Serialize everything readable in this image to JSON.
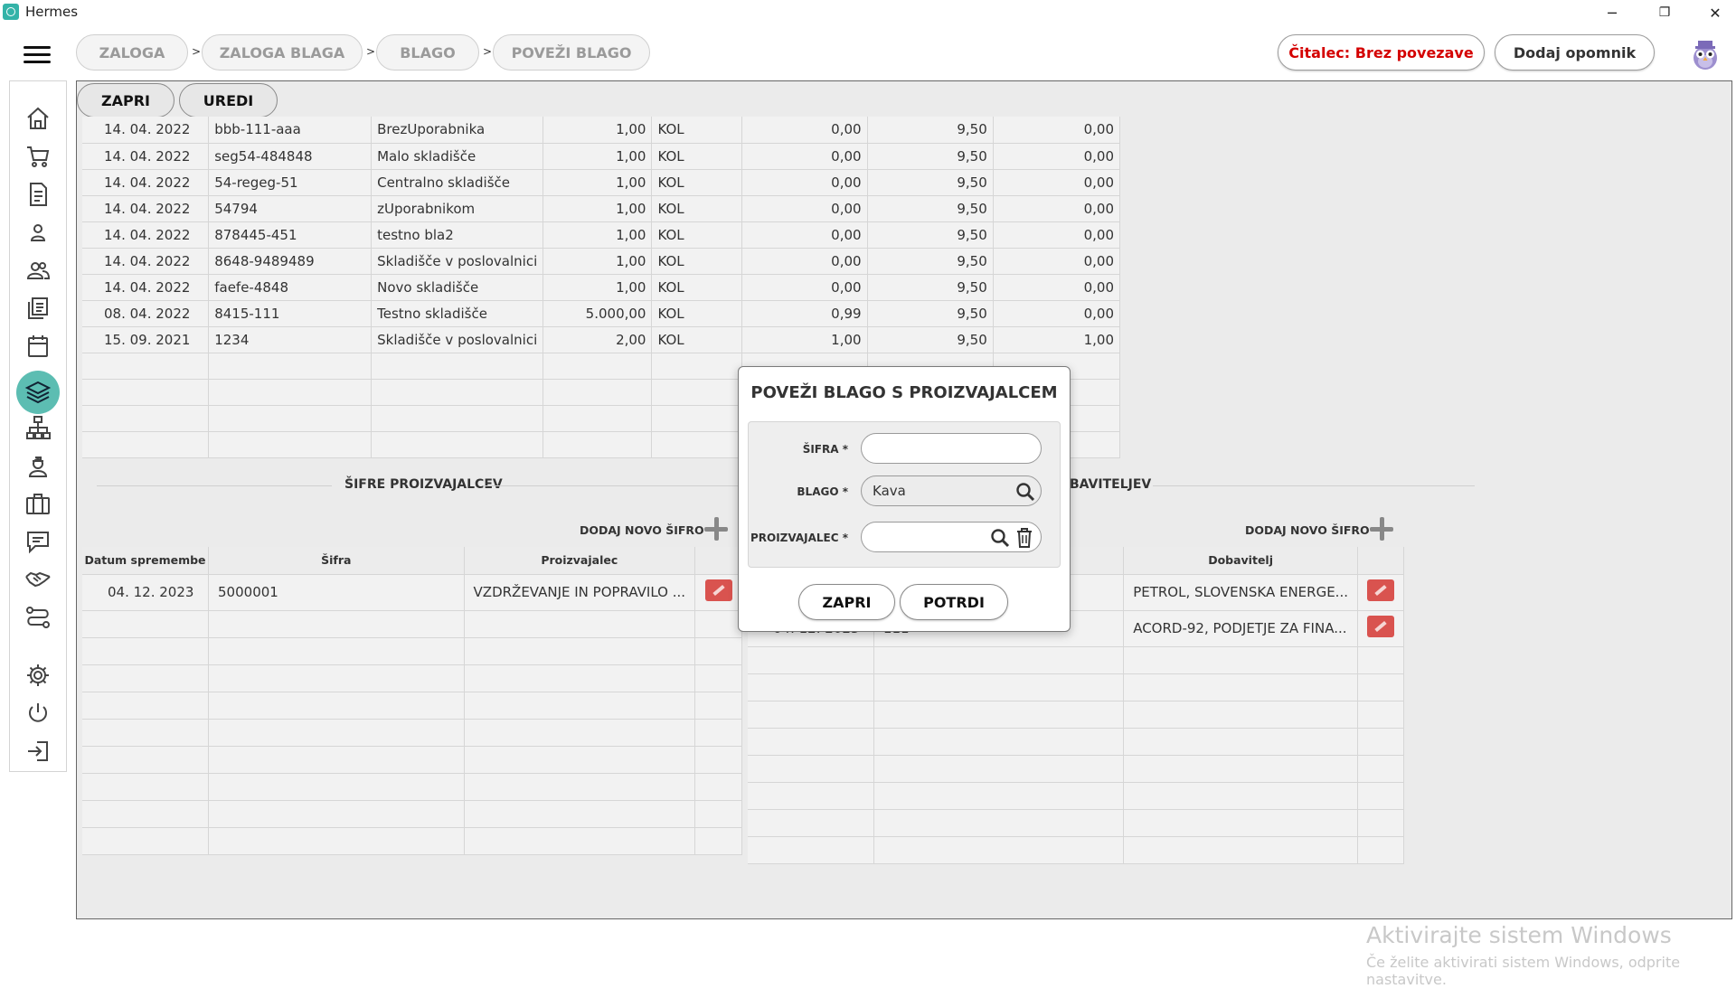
{
  "app": {
    "title": "Hermes"
  },
  "window_controls": {
    "minimize": "─",
    "restore": "❐",
    "close": "✕"
  },
  "breadcrumb": [
    {
      "label": "ZALOGA"
    },
    {
      "label": "ZALOGA BLAGA"
    },
    {
      "label": "BLAGO"
    },
    {
      "label": "POVEŽI BLAGO"
    }
  ],
  "breadcrumb_separator": ">",
  "header": {
    "reader_status": "Čitalec: Brez povezave",
    "reader_status_color": "#d40000",
    "add_reminder": "Dodaj opomnik"
  },
  "sidebar_icons": [
    "home-icon",
    "cart-icon",
    "document-icon",
    "person-icon",
    "people-icon",
    "documents-icon",
    "calendar-icon",
    "layers-icon",
    "hierarchy-icon",
    "worker-icon",
    "briefcase-icon",
    "chat-icon",
    "handshake-icon",
    "route-icon",
    "gear-icon",
    "power-icon",
    "logout-icon"
  ],
  "toolbar": {
    "close": "ZAPRI",
    "edit": "UREDI"
  },
  "stock_table": {
    "rows": [
      [
        "14. 04. 2022",
        "bbb-111-aaa",
        "BrezUporabnika",
        "1,00",
        "KOL",
        "0,00",
        "9,50",
        "0,00"
      ],
      [
        "14. 04. 2022",
        "seg54-484848",
        "Malo skladišče",
        "1,00",
        "KOL",
        "0,00",
        "9,50",
        "0,00"
      ],
      [
        "14. 04. 2022",
        "54-regeg-51",
        "Centralno skladišče",
        "1,00",
        "KOL",
        "0,00",
        "9,50",
        "0,00"
      ],
      [
        "14. 04. 2022",
        "54794",
        "zUporabnikom",
        "1,00",
        "KOL",
        "0,00",
        "9,50",
        "0,00"
      ],
      [
        "14. 04. 2022",
        "878445-451",
        "testno bla2",
        "1,00",
        "KOL",
        "0,00",
        "9,50",
        "0,00"
      ],
      [
        "14. 04. 2022",
        "8648-9489489",
        "Skladišče v poslovalnici",
        "1,00",
        "KOL",
        "0,00",
        "9,50",
        "0,00"
      ],
      [
        "14. 04. 2022",
        "faefe-4848",
        "Novo skladišče",
        "1,00",
        "KOL",
        "0,00",
        "9,50",
        "0,00"
      ],
      [
        "08. 04. 2022",
        "8415-111",
        "Testno skladišče",
        "5.000,00",
        "KOL",
        "0,99",
        "9,50",
        "0,00"
      ],
      [
        "15. 09. 2021",
        "1234",
        "Skladišče v poslovalnici",
        "2,00",
        "KOL",
        "1,00",
        "9,50",
        "1,00"
      ]
    ]
  },
  "manufacturers": {
    "title": "ŠIFRE PROIZVAJALCEV",
    "add_label": "DODAJ NOVO ŠIFRO",
    "headers": [
      "Datum spremembe",
      "Šifra",
      "Proizvajalec"
    ],
    "rows": [
      [
        "04. 12. 2023",
        "5000001",
        "VZDRŽEVANJE IN POPRAVILO ..."
      ]
    ]
  },
  "suppliers": {
    "title_partial": "BAVITELJEV",
    "add_label": "DODAJ NOVO ŠIFRO",
    "headers": [
      "Dobavitelj"
    ],
    "rows": [
      {
        "date": "",
        "code": "",
        "supplier": "PETROL, SLOVENSKA ENERGE..."
      },
      {
        "date": "04. 12. 2023",
        "code": "111",
        "supplier": "ACORD-92, PODJETJE ZA FINA..."
      }
    ]
  },
  "modal": {
    "title": "POVEŽI BLAGO S PROIZVAJALCEM",
    "fields": {
      "code_label": "ŠIFRA *",
      "code_value": "",
      "goods_label": "BLAGO *",
      "goods_value": "Kava",
      "manufacturer_label": "PROIZVAJALEC *",
      "manufacturer_value": ""
    },
    "close": "ZAPRI",
    "confirm": "POTRDI"
  },
  "watermark": {
    "line1": "Aktivirajte sistem Windows",
    "line2": "Če želite aktivirati sistem Windows, odprite nastavitve."
  },
  "colors": {
    "accent": "#5cbdb2",
    "edit": "#d9534f"
  }
}
